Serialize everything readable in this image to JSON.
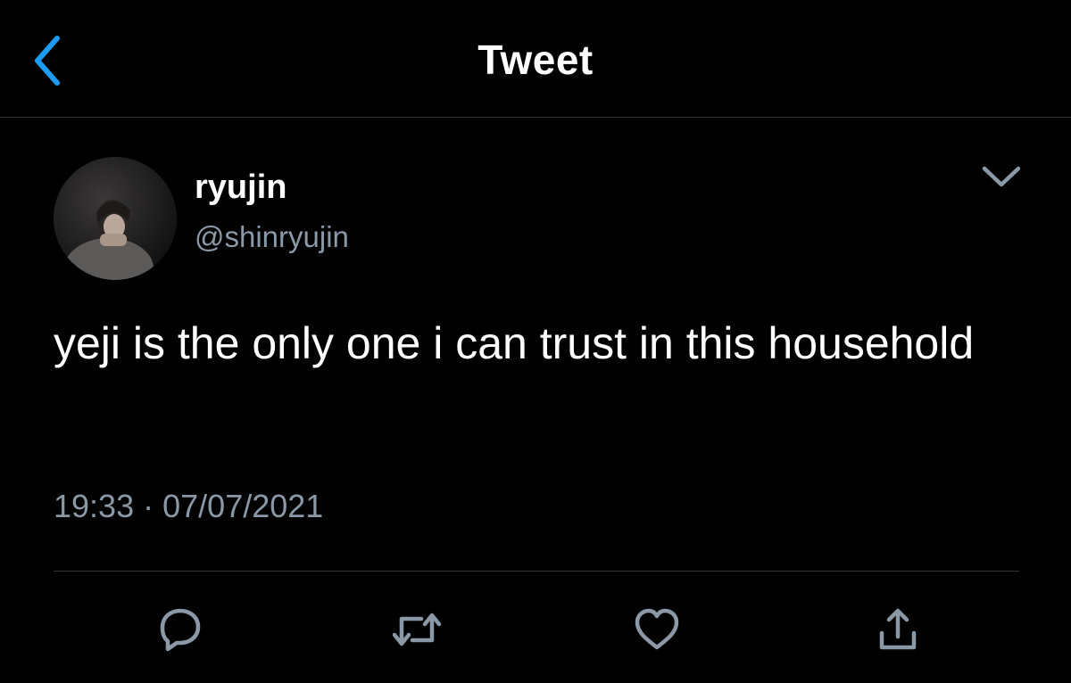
{
  "nav": {
    "title": "Tweet"
  },
  "tweet": {
    "display_name": "ryujin",
    "handle": "@shinryujin",
    "text": "yeji is the only one i can trust in this household",
    "time": "19:33",
    "separator": "·",
    "date": "07/07/2021"
  },
  "actions": [
    {
      "icon": "reply-icon"
    },
    {
      "icon": "retweet-icon"
    },
    {
      "icon": "like-icon"
    },
    {
      "icon": "share-icon"
    }
  ],
  "colors": {
    "background": "#000000",
    "accent": "#1d9bf0",
    "secondary_text": "#8b98a5",
    "divider": "#2f3336"
  }
}
